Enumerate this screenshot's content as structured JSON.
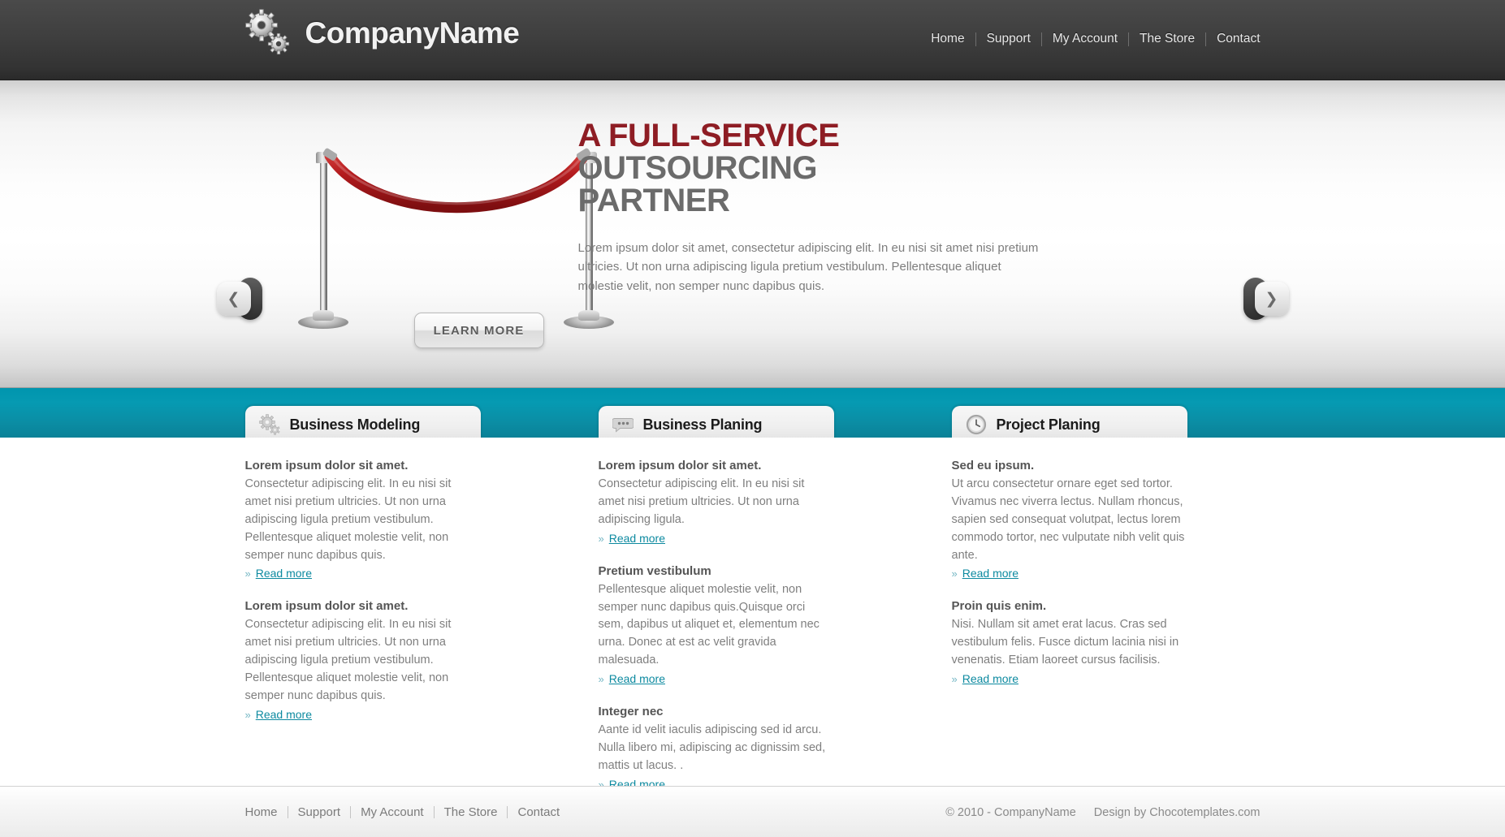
{
  "header": {
    "brand": "CompanyName",
    "logo_icon": "gears-icon",
    "nav": [
      {
        "label": "Home"
      },
      {
        "label": "Support"
      },
      {
        "label": "My Account"
      },
      {
        "label": "The Store"
      },
      {
        "label": "Contact"
      }
    ]
  },
  "hero": {
    "headline_red": "A FULL-SERVICE",
    "headline_gray_line1": "OUTSOURCING",
    "headline_gray_line2": "PARTNER",
    "paragraph": "Lorem ipsum dolor sit amet, consectetur adipiscing elit. In eu nisi sit amet nisi pretium ultricies. Ut non urna adipiscing ligula pretium vestibulum. Pellentesque aliquet molestie velit, non semper nunc dapibus quis.",
    "cta_label": "LEARN MORE",
    "prev_arrow_icon": "chevron-left-icon",
    "next_arrow_icon": "chevron-right-icon",
    "illustration": "velvet-rope-barrier"
  },
  "columns": [
    {
      "tab_label": "Business Modeling",
      "tab_icon": "gears-icon",
      "blocks": [
        {
          "heading": "Lorem ipsum dolor sit amet.",
          "body": "Consectetur adipiscing elit. In eu nisi sit amet nisi pretium ultricies. Ut non urna adipiscing ligula pretium vestibulum. Pellentesque aliquet molestie velit, non semper nunc dapibus quis.",
          "link": "Read more"
        },
        {
          "heading": "Lorem ipsum dolor sit amet.",
          "body": "Consectetur adipiscing elit. In eu nisi sit amet nisi pretium ultricies. Ut non urna adipiscing ligula pretium vestibulum. Pellentesque aliquet molestie velit, non semper nunc dapibus quis.",
          "link": "Read more"
        }
      ]
    },
    {
      "tab_label": "Business Planing",
      "tab_icon": "speech-bubble-icon",
      "blocks": [
        {
          "heading": "Lorem ipsum dolor sit amet.",
          "body": "Consectetur adipiscing elit. In eu nisi sit amet nisi pretium ultricies. Ut non urna adipiscing ligula.",
          "link": "Read more"
        },
        {
          "heading": "Pretium vestibulum",
          "body": "Pellentesque aliquet molestie velit, non semper nunc dapibus quis.Quisque orci sem, dapibus ut aliquet et, elementum nec urna. Donec at est ac velit gravida malesuada.",
          "link": "Read more"
        },
        {
          "heading": "Integer nec",
          "body": "Aante id velit iaculis adipiscing sed id arcu. Nulla libero mi, adipiscing ac dignissim sed, mattis ut lacus. .",
          "link": "Read more"
        }
      ]
    },
    {
      "tab_label": "Project Planing",
      "tab_icon": "clock-icon",
      "blocks": [
        {
          "heading": "Sed eu ipsum.",
          "body": "Ut arcu consectetur ornare eget sed tortor. Vivamus nec viverra lectus. Nullam rhoncus, sapien sed consequat volutpat, lectus lorem commodo tortor, nec vulputate nibh velit quis ante.",
          "link": "Read more"
        },
        {
          "heading": "Proin quis enim.",
          "body": "Nisi. Nullam sit amet erat lacus. Cras sed vestibulum felis. Fusce dictum lacinia nisi in venenatis. Etiam laoreet cursus facilisis.",
          "link": "Read more"
        }
      ]
    }
  ],
  "footer": {
    "nav": [
      {
        "label": "Home"
      },
      {
        "label": "Support"
      },
      {
        "label": "My Account"
      },
      {
        "label": "The Store"
      },
      {
        "label": "Contact"
      }
    ],
    "copyright": "© 2010 - CompanyName",
    "credit": "Design by Chocotemplates.com"
  },
  "colors": {
    "header_bg": "#3a3a3a",
    "accent_teal": "#0b8da4",
    "headline_red": "#8e1d24",
    "headline_gray": "#6b6b6b",
    "link_teal": "#0d8aa0",
    "rope_red": "#b5181c"
  }
}
